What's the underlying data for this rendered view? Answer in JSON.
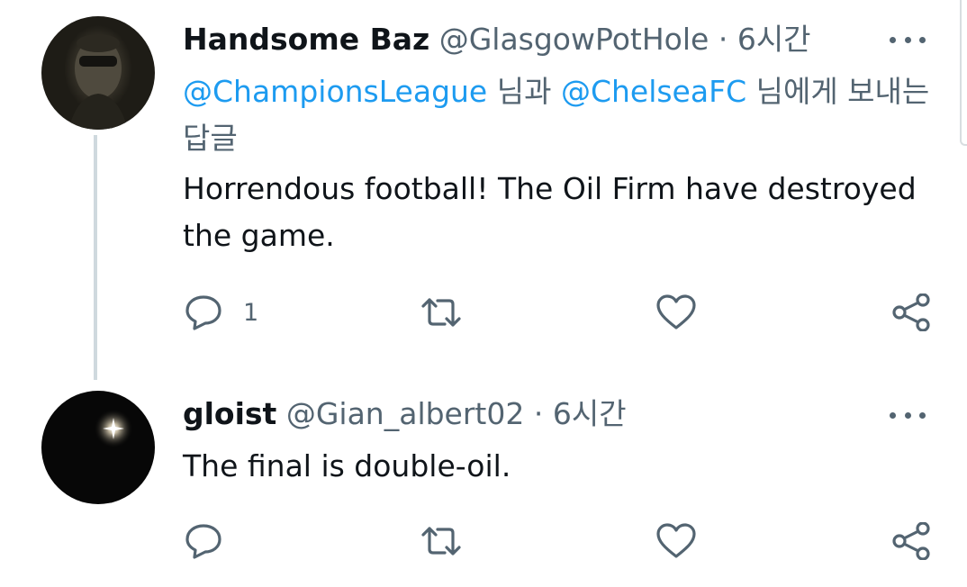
{
  "tweets": [
    {
      "display_name": "Handsome Baz",
      "handle": "@GlasgowPotHole",
      "separator": "·",
      "time": "6시간",
      "reply_to": {
        "mention1": "@ChampionsLeague",
        "connector": " 님과 ",
        "mention2": "@ChelseaFC",
        "suffix": " 님에게 보내는 답글"
      },
      "text": "Horrendous football! The Oil Firm have destroyed the game.",
      "reply_count": "1"
    },
    {
      "display_name": "gloist",
      "handle": "@Gian_albert02",
      "separator": "·",
      "time": "6시간",
      "text": "The final is double-oil."
    }
  ],
  "icons": [
    "reply-icon",
    "retweet-icon",
    "like-icon",
    "share-icon",
    "more-icon"
  ],
  "colors": {
    "link": "#1d9bf0",
    "secondary_text": "#536471",
    "thread_line": "#cfd9de"
  }
}
